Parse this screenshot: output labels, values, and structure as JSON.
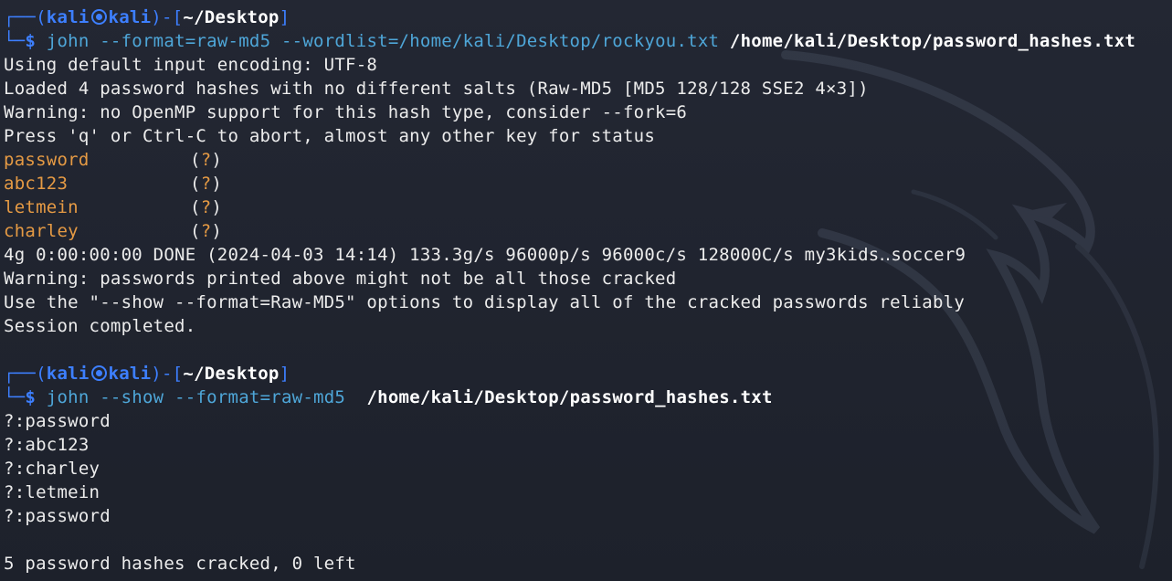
{
  "window": {
    "type": "terminal"
  },
  "prompt1": {
    "box_top": "┌──(",
    "user": "kali",
    "host": "kali",
    "close": ")-[",
    "cwd": "~/Desktop",
    "close2": "]",
    "box_bottom": "└─",
    "dollar": "$",
    "command": "john --format=raw-md5 --wordlist=/home/kali/Desktop/rockyou.txt",
    "command_arg": "/home/kali/Desktop/password_hashes.txt"
  },
  "output1": {
    "lines": [
      "Using default input encoding: UTF-8",
      "Loaded 4 password hashes with no different salts (Raw-MD5 [MD5 128/128 SSE2 4×3])",
      "Warning: no OpenMP support for this hash type, consider --fork=6",
      "Press 'q' or Ctrl-C to abort, almost any other key for status"
    ],
    "cracked": [
      {
        "password": "password",
        "open": "(",
        "mark": "?",
        "close": ")"
      },
      {
        "password": "abc123",
        "open": "(",
        "mark": "?",
        "close": ")"
      },
      {
        "password": "letmein",
        "open": "(",
        "mark": "?",
        "close": ")"
      },
      {
        "password": "charley",
        "open": "(",
        "mark": "?",
        "close": ")"
      }
    ],
    "summary_lines": [
      "4g 0:00:00:00 DONE (2024-04-03 14:14) 133.3g/s 96000p/s 96000c/s 128000C/s my3kids‥soccer9",
      "Warning: passwords printed above might not be all those cracked",
      "Use the \"--show --format=Raw-MD5\" options to display all of the cracked passwords reliably",
      "Session completed."
    ]
  },
  "prompt2": {
    "box_top": "┌──(",
    "user": "kali",
    "host": "kali",
    "close": ")-[",
    "cwd": "~/Desktop",
    "close2": "]",
    "box_bottom": "└─",
    "dollar": "$",
    "command": "john --show --format=raw-md5 ",
    "command_arg": "/home/kali/Desktop/password_hashes.txt"
  },
  "output2": {
    "lines": [
      "?:password",
      "?:abc123",
      "?:charley",
      "?:letmein",
      "?:password"
    ],
    "final": "5 password hashes cracked, 0 left"
  },
  "colors": {
    "background": "#1f2430",
    "prompt_blue": "#3d7fff",
    "command_cyan": "#4ea6d8",
    "password_orange": "#e59a44",
    "text": "#ececec"
  }
}
